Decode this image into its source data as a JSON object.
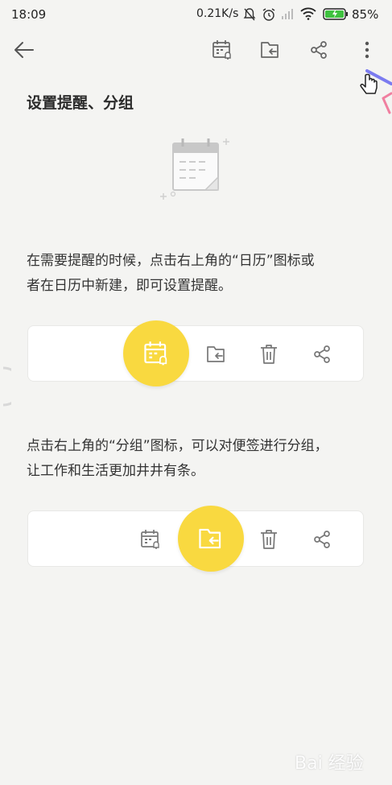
{
  "status_bar": {
    "time": "18:09",
    "net_speed": "0.21K/s",
    "battery": "85%",
    "icons": [
      "mute-icon",
      "alarm-icon",
      "signal-icon",
      "wifi-icon",
      "battery-icon"
    ]
  },
  "toolbar": {
    "icons": [
      "back-arrow-icon",
      "calendar-reminder-icon",
      "folder-move-icon",
      "share-icon",
      "more-vertical-icon"
    ]
  },
  "note": {
    "title": "设置提醒、分组",
    "paragraph1_line1": "在需要提醒的时候，点击右上角的“日历”图标或",
    "paragraph1_line2": "者在日历中新建，即可设置提醒。",
    "paragraph2_line1": "点击右上角的“分组”图标，可以对便签进行分组，",
    "paragraph2_line2": "让工作和生活更加井井有条。"
  },
  "colors": {
    "highlight": "#f9d940",
    "icon_gray": "#777777",
    "background": "#f4f4f2"
  },
  "watermark": "Bai 经验"
}
